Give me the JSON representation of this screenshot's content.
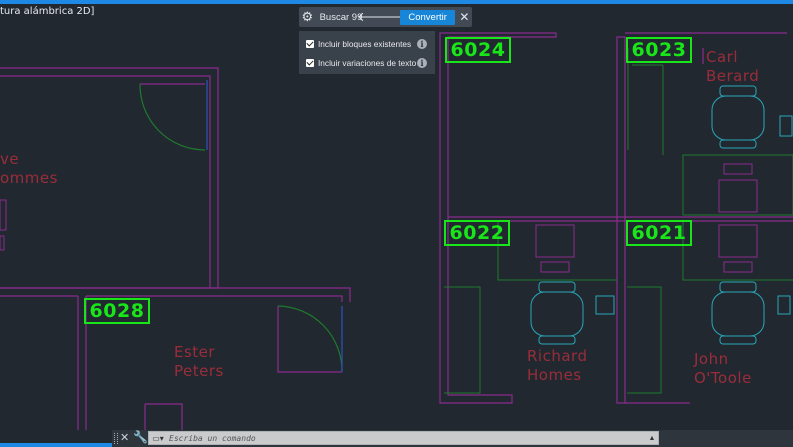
{
  "viewport": {
    "label": "tura alámbrica 2D]"
  },
  "find_bar": {
    "gear_icon": "gear-icon",
    "search_text": "Buscar 99",
    "prev_icon": "arrow-left-icon",
    "next_icon": "arrow-right-icon",
    "convert_label": "Convertir",
    "close_icon": "close-icon"
  },
  "find_options": {
    "include_blocks": {
      "label": "Incluir bloques existentes",
      "checked": true
    },
    "include_variations": {
      "label": "Incluir variaciones de texto",
      "checked": true
    }
  },
  "drawing": {
    "room_tags": [
      "6024",
      "6023",
      "6022",
      "6021",
      "6028"
    ],
    "names": {
      "carl": "Carl\nBerard",
      "steve": "ve\nommes",
      "ester": "Ester\nPeters",
      "richard": "Richard\nHomes",
      "john": "John\nO'Toole"
    }
  },
  "command_line": {
    "placeholder": "Escriba un comando"
  },
  "colors": {
    "background": "#212830",
    "wall": "#8a2c8e",
    "tag": "#19e619",
    "furniture": "#2aa6b8",
    "partition": "#1f7a2e",
    "name_text": "#9a2d3a",
    "accent": "#1e88e5"
  }
}
